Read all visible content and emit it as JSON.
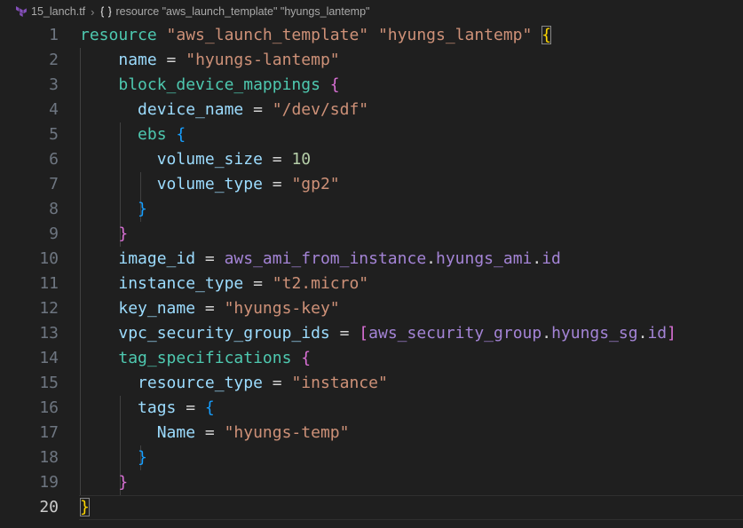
{
  "breadcrumb": {
    "file": "15_lanch.tf",
    "symbol": "resource \"aws_launch_template\" \"hyungs_lantemp\""
  },
  "editor": {
    "active_line": 20,
    "line_numbers": [
      "1",
      "2",
      "3",
      "4",
      "5",
      "6",
      "7",
      "8",
      "9",
      "10",
      "11",
      "12",
      "13",
      "14",
      "15",
      "16",
      "17",
      "18",
      "19",
      "20"
    ],
    "tokens": {
      "l1_kw": "resource",
      "l1_s1": "\"aws_launch_template\"",
      "l1_s2": "\"hyungs_lantemp\"",
      "l1_b": "{",
      "l2_a": "name",
      "l2_eq": " = ",
      "l2_v": "\"hyungs-lantemp\"",
      "l3_k": "block_device_mappings",
      "l3_b": "{",
      "l4_a": "device_name",
      "l4_eq": " = ",
      "l4_v": "\"/dev/sdf\"",
      "l5_k": "ebs",
      "l5_b": "{",
      "l6_a": "volume_size",
      "l6_eq": " = ",
      "l6_v": "10",
      "l7_a": "volume_type",
      "l7_eq": " = ",
      "l7_v": "\"gp2\"",
      "l8_b": "}",
      "l9_b": "}",
      "l10_a": "image_id",
      "l10_eq": " = ",
      "l10_r1": "aws_ami_from_instance",
      "l10_d1": ".",
      "l10_r2": "hyungs_ami",
      "l10_d2": ".",
      "l10_r3": "id",
      "l11_a": "instance_type",
      "l11_eq": " = ",
      "l11_v": "\"t2.micro\"",
      "l12_a": "key_name",
      "l12_eq": " = ",
      "l12_v": "\"hyungs-key\"",
      "l13_a": "vpc_security_group_ids",
      "l13_eq": " = ",
      "l13_ob": "[",
      "l13_r1": "aws_security_group",
      "l13_d1": ".",
      "l13_r2": "hyungs_sg",
      "l13_d2": ".",
      "l13_r3": "id",
      "l13_cb": "]",
      "l14_k": "tag_specifications",
      "l14_b": "{",
      "l15_a": "resource_type",
      "l15_eq": " = ",
      "l15_v": "\"instance\"",
      "l16_a": "tags",
      "l16_eq": " = ",
      "l16_b": "{",
      "l17_a": "Name",
      "l17_eq": " = ",
      "l17_v": "\"hyungs-temp\"",
      "l18_b": "}",
      "l19_b": "}",
      "l20_b": "}"
    }
  },
  "colors": {
    "background": "#1f1f1f",
    "keyword": "#4ec9b0",
    "string": "#ce9178",
    "attribute": "#9cdcfe",
    "number": "#b5cea8",
    "brace_level1": "#ffd700",
    "brace_level2": "#da70d6",
    "brace_level3": "#179fff"
  },
  "icons": {
    "file_icon": "terraform-icon",
    "symbol_icon": "symbol-structure-icon"
  }
}
